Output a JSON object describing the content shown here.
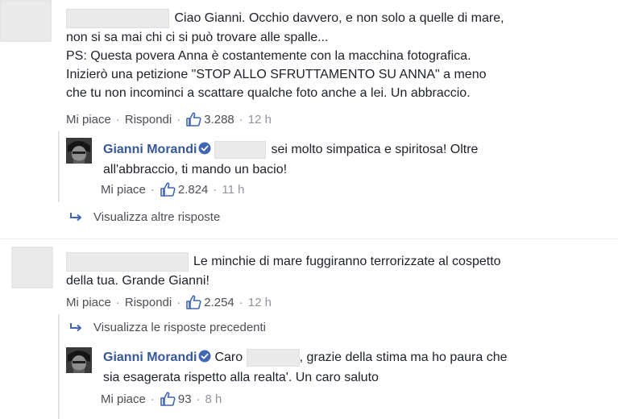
{
  "comments": [
    {
      "text_lines": [
        "Ciao Gianni. Occhio davvero, e non solo a quelle di mare,",
        "non si sa mai chi ci si può trovare alle spalle...",
        "PS: Questa povera Anna è costantemente con la macchina fotografica.",
        "Inizierò una petizione \"STOP ALLO SFRUTTAMENTO SU ANNA\" a meno",
        "che tu non incominci a scattare qualche foto anche a lei. Un abbraccio."
      ],
      "like_label": "Mi piace",
      "reply_label": "Rispondi",
      "likes": "3.288",
      "time": "12 h",
      "reply": {
        "author": "Gianni Morandi",
        "line1": "sei molto simpatica e spiritosa! Oltre",
        "line2": "all'abbraccio, ti mando un bacio!",
        "like_label": "Mi piace",
        "likes": "2.824",
        "time": "11 h"
      },
      "more_replies_label": "Visualizza altre risposte"
    },
    {
      "text_line1": "Le minchie di mare fuggiranno terrorizzate al cospetto",
      "text_line2": "della tua. Grande Gianni!",
      "like_label": "Mi piace",
      "reply_label": "Rispondi",
      "likes": "2.254",
      "time": "12 h",
      "previous_replies_label": "Visualizza le risposte precedenti",
      "reply": {
        "author": "Gianni Morandi",
        "prefix": "Caro",
        "line1": ", grazie della stima ma ho paura che",
        "line2": "sia esagerata rispetto alla realta'. Un caro saluto",
        "like_label": "Mi piace",
        "likes": "93",
        "time": "8 h"
      }
    }
  ],
  "colors": {
    "link_blue": "#365899",
    "like_blue": "#4267b2",
    "text": "#1d2129",
    "meta": "#90949c"
  },
  "icons": {
    "like": "thumbs-up-icon",
    "verified": "verified-badge-icon",
    "reply_arrow": "reply-arrow-icon"
  }
}
